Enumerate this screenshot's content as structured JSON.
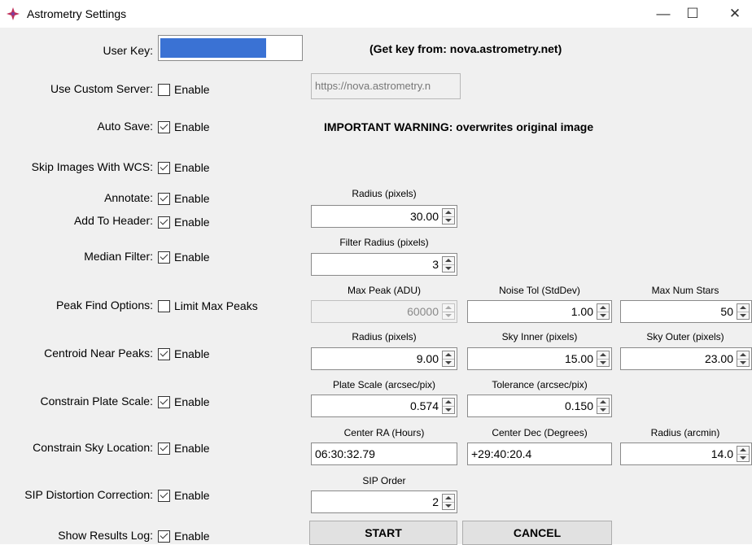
{
  "window": {
    "title": "Astrometry Settings"
  },
  "colors": {
    "key_fill": "#3a72d4",
    "icon": "#c0305a"
  },
  "user_key": {
    "label": "User Key:",
    "hint": "(Get key from: nova.astrometry.net)"
  },
  "custom_server": {
    "label": "Use Custom Server:",
    "option": "Enable",
    "checked": false,
    "url": "https://nova.astrometry.n"
  },
  "auto_save": {
    "label": "Auto Save:",
    "option": "Enable",
    "checked": true,
    "warning": "IMPORTANT WARNING: overwrites original image"
  },
  "skip_wcs": {
    "label": "Skip Images With WCS:",
    "option": "Enable",
    "checked": true
  },
  "annotate": {
    "label": "Annotate:",
    "option": "Enable",
    "checked": true,
    "radius_header": "Radius (pixels)",
    "radius_value": "30.00"
  },
  "add_header": {
    "label": "Add To Header:",
    "option": "Enable",
    "checked": true
  },
  "median_filter": {
    "label": "Median Filter:",
    "option": "Enable",
    "checked": true,
    "radius_header": "Filter Radius (pixels)",
    "radius_value": "3"
  },
  "peak_find": {
    "label": "Peak Find Options:",
    "option": "Limit Max Peaks",
    "checked": false,
    "max_peak_header": "Max Peak (ADU)",
    "max_peak_value": "60000",
    "noise_header": "Noise Tol (StdDev)",
    "noise_value": "1.00",
    "max_stars_header": "Max Num Stars",
    "max_stars_value": "50"
  },
  "centroid": {
    "label": "Centroid Near Peaks:",
    "option": "Enable",
    "checked": true,
    "radius_header": "Radius (pixels)",
    "radius_value": "9.00",
    "sky_inner_header": "Sky Inner (pixels)",
    "sky_inner_value": "15.00",
    "sky_outer_header": "Sky Outer (pixels)",
    "sky_outer_value": "23.00"
  },
  "plate_scale": {
    "label": "Constrain Plate Scale:",
    "option": "Enable",
    "checked": true,
    "scale_header": "Plate Scale (arcsec/pix)",
    "scale_value": "0.574",
    "tol_header": "Tolerance (arcsec/pix)",
    "tol_value": "0.150"
  },
  "sky_location": {
    "label": "Constrain Sky Location:",
    "option": "Enable",
    "checked": true,
    "ra_header": "Center RA (Hours)",
    "ra_value": "06:30:32.79",
    "dec_header": "Center Dec (Degrees)",
    "dec_value": "+29:40:20.4",
    "radius_header": "Radius (arcmin)",
    "radius_value": "14.0"
  },
  "sip": {
    "label": "SIP Distortion Correction:",
    "option": "Enable",
    "checked": true,
    "order_header": "SIP Order",
    "order_value": "2"
  },
  "results_log": {
    "label": "Show Results Log:",
    "option": "Enable",
    "checked": true
  },
  "buttons": {
    "start": "START",
    "cancel": "CANCEL"
  }
}
